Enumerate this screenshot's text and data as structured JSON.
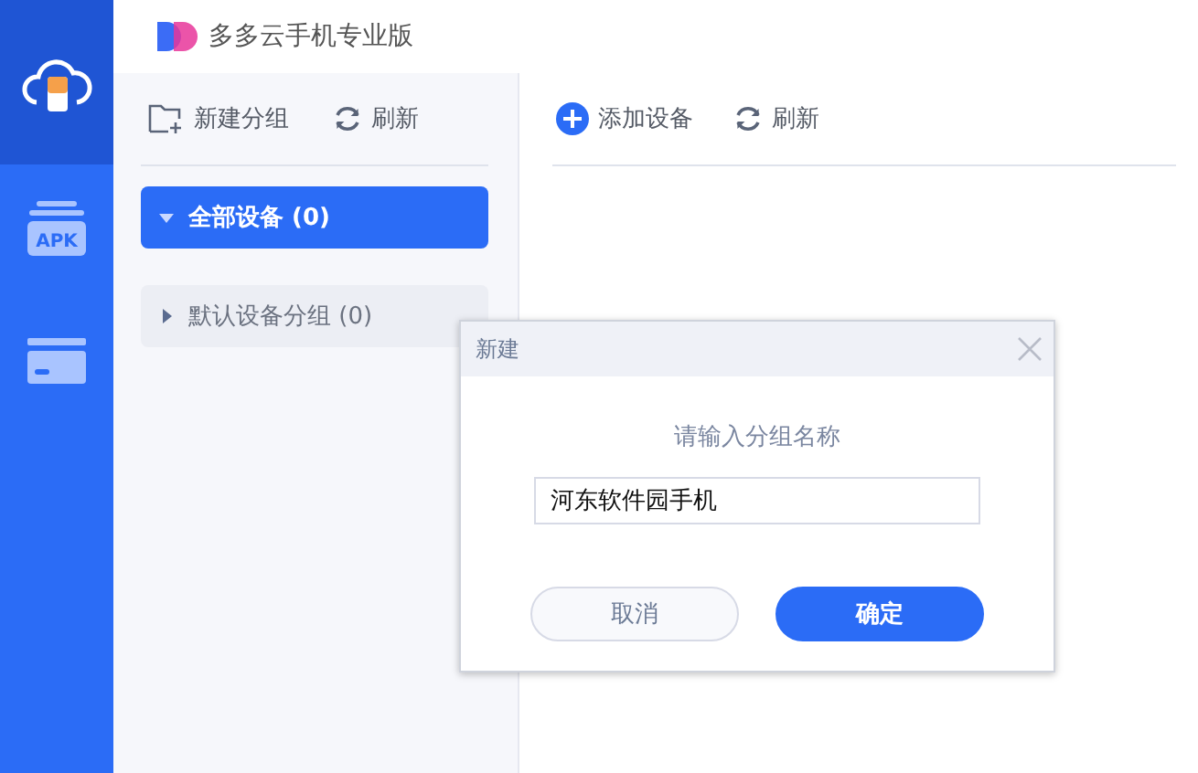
{
  "window": {
    "title": "多多云手机专业版"
  },
  "nav": [
    {
      "kind": "phone",
      "selected": true
    },
    {
      "kind": "apk",
      "label": "APK",
      "selected": false
    },
    {
      "kind": "card",
      "selected": false
    }
  ],
  "group_toolbar": {
    "new_group": "新建分组",
    "refresh": "刷新"
  },
  "groups": [
    {
      "label": "全部设备 (0)",
      "selected": true,
      "expanded": true
    },
    {
      "label": "默认设备分组 (0)",
      "selected": false,
      "expanded": false
    }
  ],
  "main_toolbar": {
    "add_device": "添加设备",
    "refresh": "刷新"
  },
  "dialog": {
    "title": "新建",
    "prompt": "请输入分组名称",
    "value": "河东软件园手机",
    "buttons": [
      {
        "kind": "secondary",
        "label": "取消"
      },
      {
        "kind": "primary",
        "label": "确定"
      }
    ]
  }
}
